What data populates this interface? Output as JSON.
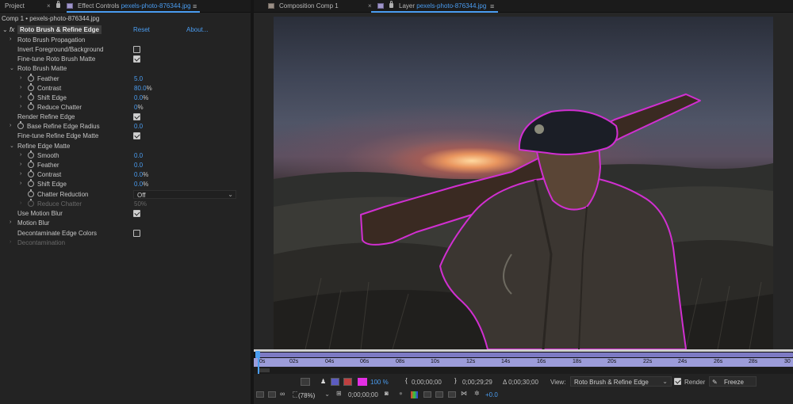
{
  "left_panel": {
    "tabs": {
      "project": "Project",
      "effect_controls_label": "Effect Controls",
      "effect_controls_file": "pexels-photo-876344.jpg"
    },
    "breadcrumb": "Comp 1 • pexels-photo-876344.jpg",
    "effect": {
      "fx": "fx",
      "name": "Roto Brush & Refine Edge",
      "reset": "Reset",
      "about": "About..."
    },
    "rows": [
      {
        "label": "Roto Brush Propagation"
      },
      {
        "label": "Invert Foreground/Background"
      },
      {
        "label": "Fine-tune Roto Brush Matte"
      },
      {
        "label": "Roto Brush Matte"
      },
      {
        "label": "Feather",
        "value": "5.0"
      },
      {
        "label": "Contrast",
        "value": "80.0",
        "unit": "%"
      },
      {
        "label": "Shift Edge",
        "value": "0.0",
        "unit": "%"
      },
      {
        "label": "Reduce Chatter",
        "value": "0",
        "unit": "%"
      },
      {
        "label": "Render Refine Edge"
      },
      {
        "label": "Base Refine Edge Radius",
        "value": "0.0"
      },
      {
        "label": "Fine-tune Refine Edge Matte"
      },
      {
        "label": "Refine Edge Matte"
      },
      {
        "label": "Smooth",
        "value": "0.0"
      },
      {
        "label": "Feather",
        "value": "0.0"
      },
      {
        "label": "Contrast",
        "value": "0.0",
        "unit": "%"
      },
      {
        "label": "Shift Edge",
        "value": "0.0",
        "unit": "%"
      },
      {
        "label": "Chatter Reduction",
        "value": "Off"
      },
      {
        "label": "Reduce Chatter",
        "value": "50",
        "unit": "%"
      },
      {
        "label": "Use Motion Blur"
      },
      {
        "label": "Motion Blur"
      },
      {
        "label": "Decontaminate Edge Colors"
      },
      {
        "label": "Decontamination"
      }
    ]
  },
  "right_panel": {
    "tabs": {
      "composition": "Composition Comp 1",
      "layer_label": "Layer",
      "layer_file": "pexels-photo-876344.jpg"
    },
    "timeline_ticks": [
      "0s",
      "02s",
      "04s",
      "06s",
      "08s",
      "10s",
      "12s",
      "14s",
      "16s",
      "18s",
      "20s",
      "22s",
      "24s",
      "26s",
      "28s",
      "30"
    ],
    "toolbar1": {
      "zoom_percent": "100 %",
      "in_time": "0;00;00;00",
      "out_time": "0;00;29;29",
      "duration": "Δ 0;00;30;00",
      "view_label": "View:",
      "view_value": "Roto Brush & Refine Edge",
      "render_label": "Render",
      "freeze_label": "Freeze"
    },
    "toolbar2": {
      "magnification": "(78%)",
      "current_time": "0;00;00;00",
      "exposure": "+0.0"
    }
  },
  "colors": {
    "accent_blue": "#4a9cf0",
    "timeline_purple": "#9c9cd9",
    "roto_outline": "#d12fd1"
  }
}
